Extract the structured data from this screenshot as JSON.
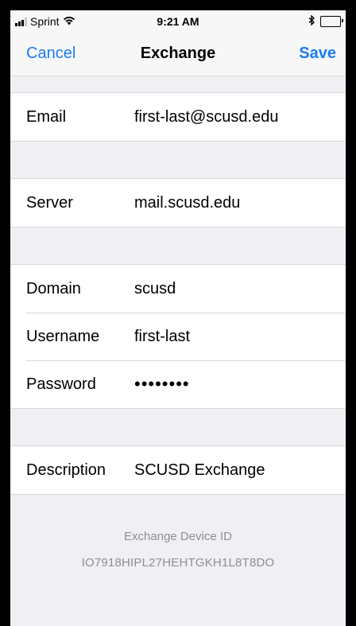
{
  "status_bar": {
    "carrier": "Sprint",
    "time": "9:21 AM"
  },
  "nav": {
    "cancel_label": "Cancel",
    "title": "Exchange",
    "save_label": "Save"
  },
  "form": {
    "email": {
      "label": "Email",
      "value": "first-last@scusd.edu"
    },
    "server": {
      "label": "Server",
      "value": "mail.scusd.edu"
    },
    "domain": {
      "label": "Domain",
      "value": "scusd"
    },
    "username": {
      "label": "Username",
      "value": "first-last"
    },
    "password": {
      "label": "Password",
      "value": "••••••••"
    },
    "description": {
      "label": "Description",
      "value": "SCUSD Exchange"
    }
  },
  "footer": {
    "device_id_label": "Exchange Device ID",
    "device_id_value": "IO7918HIPL27HEHTGKH1L8T8DO"
  },
  "colors": {
    "accent": "#1a7cf3",
    "group_background": "#efeff4",
    "secondary_text": "#8e8e93"
  }
}
